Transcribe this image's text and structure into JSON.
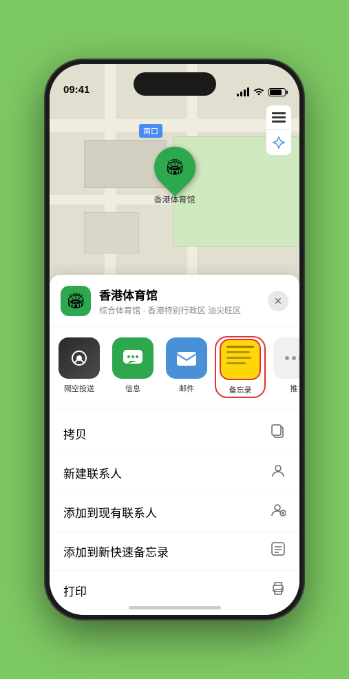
{
  "statusBar": {
    "time": "09:41",
    "locationArrow": "▶"
  },
  "map": {
    "label": "南口",
    "locationName": "香港体育馆",
    "pinEmoji": "🏟"
  },
  "bottomSheet": {
    "locationName": "香港体育馆",
    "locationDesc": "综合体育馆 · 香港特别行政区 油尖旺区",
    "closeLabel": "✕",
    "shareItems": [
      {
        "id": "airdrop",
        "label": "隔空投送",
        "emoji": "📡"
      },
      {
        "id": "message",
        "label": "信息",
        "emoji": "💬"
      },
      {
        "id": "mail",
        "label": "邮件",
        "emoji": "✉️"
      },
      {
        "id": "notes",
        "label": "备忘录",
        "emoji": ""
      },
      {
        "id": "more",
        "label": "推",
        "emoji": "···"
      }
    ],
    "actionItems": [
      {
        "id": "copy",
        "label": "拷贝",
        "icon": "⧉"
      },
      {
        "id": "new-contact",
        "label": "新建联系人",
        "icon": "👤"
      },
      {
        "id": "add-existing",
        "label": "添加到现有联系人",
        "icon": "👤"
      },
      {
        "id": "quick-note",
        "label": "添加到新快速备忘录",
        "icon": "⊡"
      },
      {
        "id": "print",
        "label": "打印",
        "icon": "🖨"
      }
    ]
  },
  "moreDots": {
    "colors": [
      "#ff3b30",
      "#ff9500",
      "#34c759"
    ]
  }
}
